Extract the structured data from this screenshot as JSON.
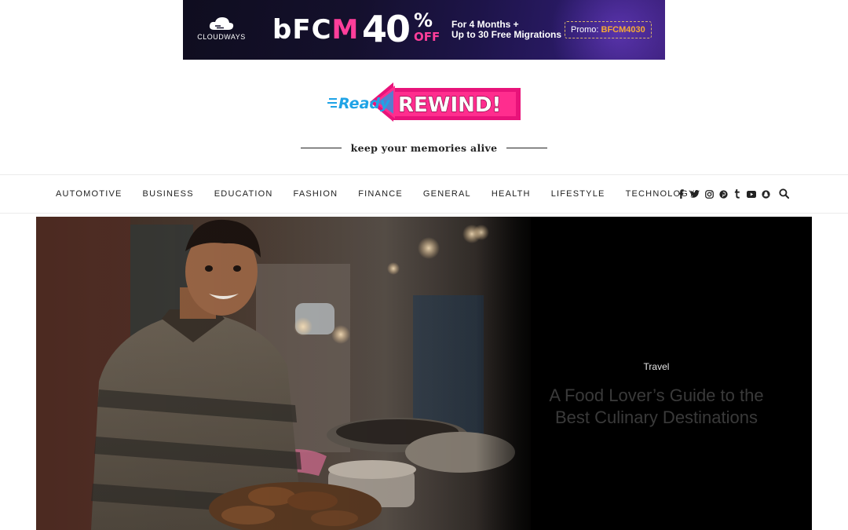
{
  "ad": {
    "brand": "CLOUDWAYS",
    "campaign_bf": "bFC",
    "campaign_m": "M",
    "discount": "40",
    "percent": "%",
    "off": "OFF",
    "line1": "For 4 Months +",
    "line2": "Up to 30 Free Migrations",
    "promo_label": "Promo: ",
    "promo_code": "BFCM4030",
    "colors": {
      "background": "#14102c",
      "accent": "#ff3e9a",
      "promo": "#f6a935"
    }
  },
  "site": {
    "logo_ready": "Ready",
    "logo_rewind": "REWIND!",
    "tagline": "keep your memories alive",
    "colors": {
      "logo_pink": "#e8137a",
      "logo_blue": "#1fa3e6"
    }
  },
  "nav": {
    "items": [
      "AUTOMOTIVE",
      "BUSINESS",
      "EDUCATION",
      "FASHION",
      "FINANCE",
      "GENERAL",
      "HEALTH",
      "LIFESTYLE",
      "TECHNOLOGY"
    ],
    "social_icons": [
      "facebook-icon",
      "twitter-icon",
      "instagram-icon",
      "pinterest-icon",
      "tumblr-icon",
      "youtube-icon",
      "snapchat-icon"
    ],
    "search_icon": "search-icon"
  },
  "hero": {
    "category": "Travel",
    "title_line1": "A Food Lover’s Guide to the",
    "title_line2": "Best Culinary Destinations"
  }
}
